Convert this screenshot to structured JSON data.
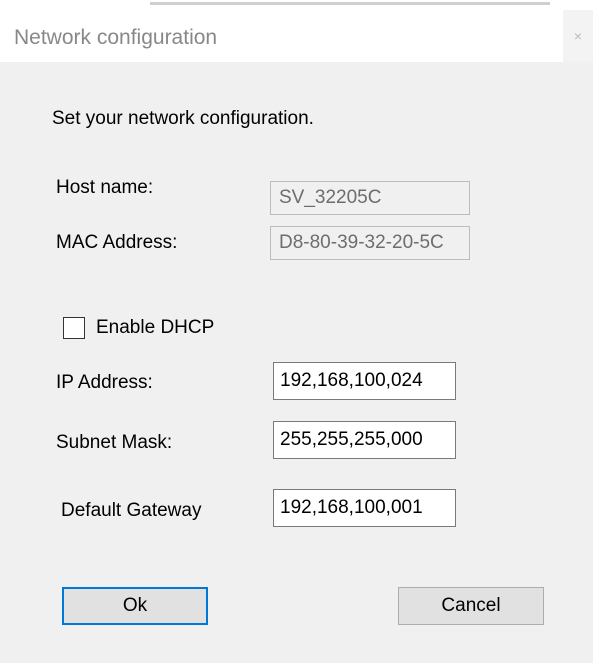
{
  "window": {
    "title": "Network configuration",
    "close_glyph": "×"
  },
  "dialog": {
    "instruction": "Set your network configuration.",
    "host_name_label": "Host name:",
    "host_name_value": "SV_32205C",
    "mac_label": "MAC Address:",
    "mac_value": "D8-80-39-32-20-5C",
    "dhcp_label": "Enable DHCP",
    "dhcp_checked": false,
    "ip_label": "IP Address:",
    "ip_value": "192,168,100,024",
    "subnet_label": "Subnet Mask:",
    "subnet_value": "255,255,255,000",
    "gateway_label": "Default Gateway",
    "gateway_value": "192,168,100,001"
  },
  "buttons": {
    "ok_label": "Ok",
    "cancel_label": "Cancel"
  },
  "colors": {
    "accent": "#0078d7",
    "dialog_bg": "#f0f0f0"
  }
}
